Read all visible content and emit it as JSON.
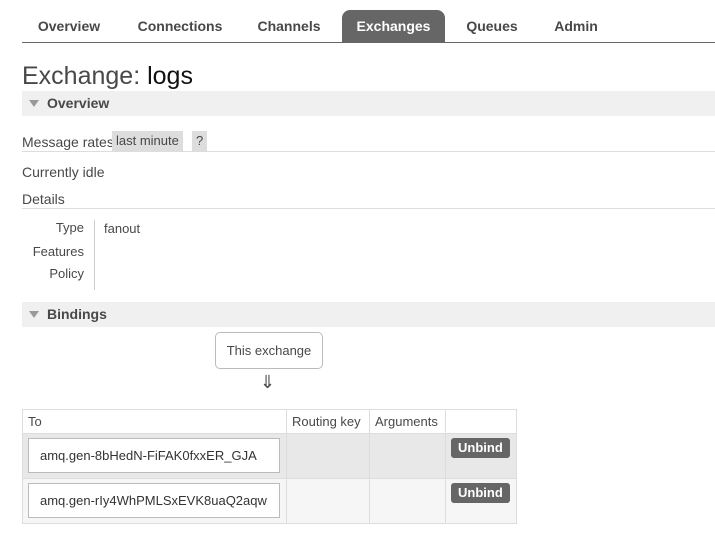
{
  "tabs": [
    {
      "label": "Overview"
    },
    {
      "label": "Connections"
    },
    {
      "label": "Channels"
    },
    {
      "label": "Exchanges",
      "active": true
    },
    {
      "label": "Queues"
    },
    {
      "label": "Admin"
    }
  ],
  "page": {
    "title_prefix": "Exchange:",
    "title_name": "logs"
  },
  "overview": {
    "header": "Overview",
    "message_rates_label": "Message rates",
    "rate_range": "last minute",
    "help": "?",
    "status": "Currently idle",
    "details_label": "Details",
    "details": {
      "type_label": "Type",
      "type_value": "fanout",
      "features_label": "Features",
      "policy_label": "Policy"
    }
  },
  "bindings": {
    "header": "Bindings",
    "source_box": "This exchange",
    "arrow": "⇓",
    "columns": [
      "To",
      "Routing key",
      "Arguments"
    ],
    "rows": [
      {
        "to": "amq.gen-8bHedN-FiFAK0fxxER_GJA",
        "routing_key": "",
        "arguments": "",
        "action": "Unbind"
      },
      {
        "to": "amq.gen-rIy4WhPMLSxEVK8uaQ2aqw",
        "routing_key": "",
        "arguments": "",
        "action": "Unbind"
      }
    ]
  }
}
